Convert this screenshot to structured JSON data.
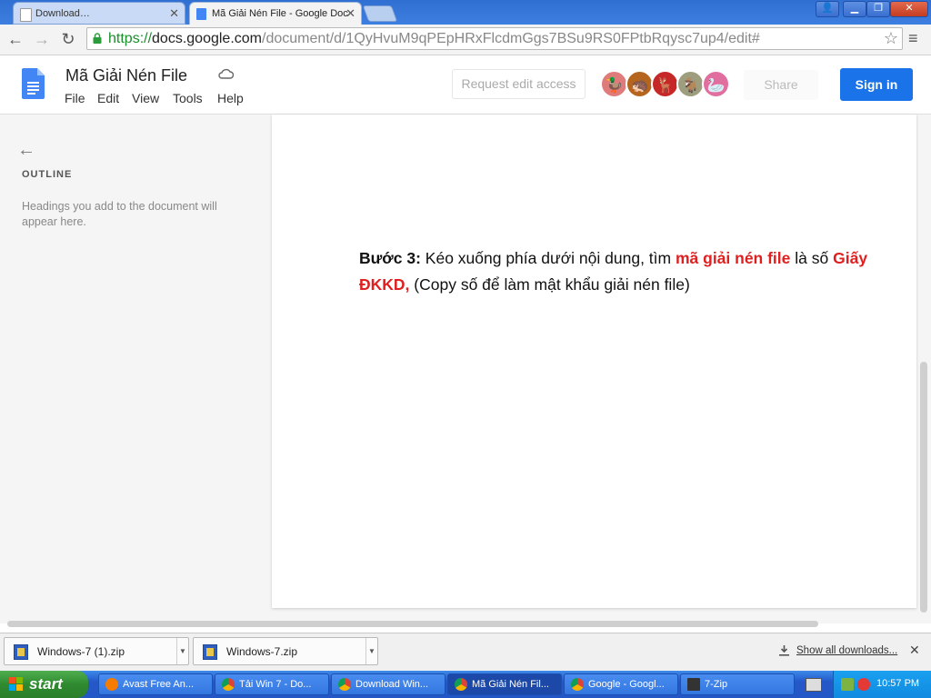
{
  "browser": {
    "tabs": [
      {
        "title": "Download…",
        "active": false
      },
      {
        "title": "Mã Giải Nén File - Google Doc",
        "active": true
      }
    ],
    "url": {
      "scheme": "https://",
      "host": "docs.google.com",
      "path": "/document/d/1QyHvuM9qPEpHRxFlcdmGgs7BSu9RS0FPtbRqysc7up4/edit#"
    }
  },
  "docs": {
    "title": "Mã Giải Nén File",
    "menu": [
      "File",
      "Edit",
      "View",
      "Tools",
      "Help"
    ],
    "request_edit": "Request edit access",
    "share": "Share",
    "signin": "Sign in",
    "avatar_colors": [
      "#e07b7b",
      "#b5651d",
      "#c62828",
      "#9e9e7e",
      "#e06fa0"
    ]
  },
  "outline": {
    "title": "OUTLINE",
    "hint": "Headings you add to the document will appear here."
  },
  "document": {
    "step_label": "Bước 3:",
    "text1": " Kéo xuống phía dưới nội dung, tìm ",
    "highlight1": "mã giải nén file",
    "text2": " là số ",
    "highlight2": "Giấy",
    "highlight3": "ĐKKD,",
    "text3": " (Copy số để làm mật khẩu giải nén file)"
  },
  "downloads": {
    "items": [
      "Windows-7 (1).zip",
      "Windows-7.zip"
    ],
    "show_all": "Show all downloads..."
  },
  "taskbar": {
    "start": "start",
    "items": [
      "Avast Free An...",
      "Tải Win 7 - Do...",
      "Download Win...",
      "Mã Giải Nén Fil...",
      "Google - Googl...",
      "7-Zip"
    ],
    "clock": "10:57 PM"
  }
}
